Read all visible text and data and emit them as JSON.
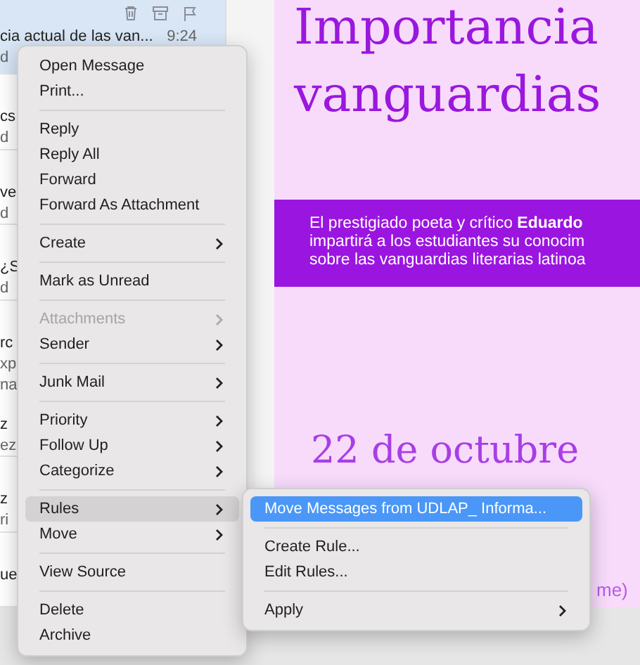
{
  "message_list": {
    "rows": [
      {
        "lines": [
          "cia actual de las van...",
          "d"
        ],
        "time": "9:24",
        "selected": true
      },
      {
        "lines": [
          "cs",
          "d"
        ],
        "selected": false
      },
      {
        "lines": [
          "ve",
          "d"
        ],
        "selected": false
      },
      {
        "lines": [
          "¿S",
          "d"
        ],
        "selected": false
      },
      {
        "lines": [
          "rc",
          "xp",
          "na"
        ],
        "selected": false
      },
      {
        "lines": [
          "z",
          "ez"
        ],
        "selected": false
      },
      {
        "lines": [
          "z",
          "ri"
        ],
        "selected": false
      },
      {
        "lines": [
          "ue"
        ],
        "selected": false
      }
    ]
  },
  "poster": {
    "title_lines": [
      "Importancia",
      "vanguardias"
    ],
    "band_lines": [
      "El prestigiado poeta y crítico **Eduardo**",
      "impartirá a los estudiantes su conocim",
      "sobre las vanguardias literarias latinoa"
    ],
    "date": "22 de octubre",
    "footer": "me)"
  },
  "context_menu": {
    "items": [
      {
        "kind": "item",
        "label": "Open Message",
        "submenu": false,
        "disabled": false,
        "selected": false
      },
      {
        "kind": "item",
        "label": "Print...",
        "submenu": false,
        "disabled": false,
        "selected": false
      },
      {
        "kind": "separator"
      },
      {
        "kind": "item",
        "label": "Reply",
        "submenu": false,
        "disabled": false,
        "selected": false
      },
      {
        "kind": "item",
        "label": "Reply All",
        "submenu": false,
        "disabled": false,
        "selected": false
      },
      {
        "kind": "item",
        "label": "Forward",
        "submenu": false,
        "disabled": false,
        "selected": false
      },
      {
        "kind": "item",
        "label": "Forward As Attachment",
        "submenu": false,
        "disabled": false,
        "selected": false
      },
      {
        "kind": "separator"
      },
      {
        "kind": "item",
        "label": "Create",
        "submenu": true,
        "disabled": false,
        "selected": false
      },
      {
        "kind": "separator"
      },
      {
        "kind": "item",
        "label": "Mark as Unread",
        "submenu": false,
        "disabled": false,
        "selected": false
      },
      {
        "kind": "separator"
      },
      {
        "kind": "item",
        "label": "Attachments",
        "submenu": true,
        "disabled": true,
        "selected": false
      },
      {
        "kind": "item",
        "label": "Sender",
        "submenu": true,
        "disabled": false,
        "selected": false
      },
      {
        "kind": "separator"
      },
      {
        "kind": "item",
        "label": "Junk Mail",
        "submenu": true,
        "disabled": false,
        "selected": false
      },
      {
        "kind": "separator"
      },
      {
        "kind": "item",
        "label": "Priority",
        "submenu": true,
        "disabled": false,
        "selected": false
      },
      {
        "kind": "item",
        "label": "Follow Up",
        "submenu": true,
        "disabled": false,
        "selected": false
      },
      {
        "kind": "item",
        "label": "Categorize",
        "submenu": true,
        "disabled": false,
        "selected": false
      },
      {
        "kind": "separator"
      },
      {
        "kind": "item",
        "label": "Rules",
        "submenu": true,
        "disabled": false,
        "selected": true
      },
      {
        "kind": "item",
        "label": "Move",
        "submenu": true,
        "disabled": false,
        "selected": false
      },
      {
        "kind": "separator"
      },
      {
        "kind": "item",
        "label": "View Source",
        "submenu": false,
        "disabled": false,
        "selected": false
      },
      {
        "kind": "separator"
      },
      {
        "kind": "item",
        "label": "Delete",
        "submenu": false,
        "disabled": false,
        "selected": false
      },
      {
        "kind": "item",
        "label": "Archive",
        "submenu": false,
        "disabled": false,
        "selected": false
      }
    ]
  },
  "submenu": {
    "items": [
      {
        "kind": "item",
        "label": "Move Messages from UDLAP_ Informa...",
        "submenu": false,
        "disabled": false,
        "selected": true
      },
      {
        "kind": "separator"
      },
      {
        "kind": "item",
        "label": "Create Rule...",
        "submenu": false,
        "disabled": false,
        "selected": false
      },
      {
        "kind": "item",
        "label": "Edit Rules...",
        "submenu": false,
        "disabled": false,
        "selected": false
      },
      {
        "kind": "separator"
      },
      {
        "kind": "item",
        "label": "Apply",
        "submenu": true,
        "disabled": false,
        "selected": false
      }
    ]
  }
}
